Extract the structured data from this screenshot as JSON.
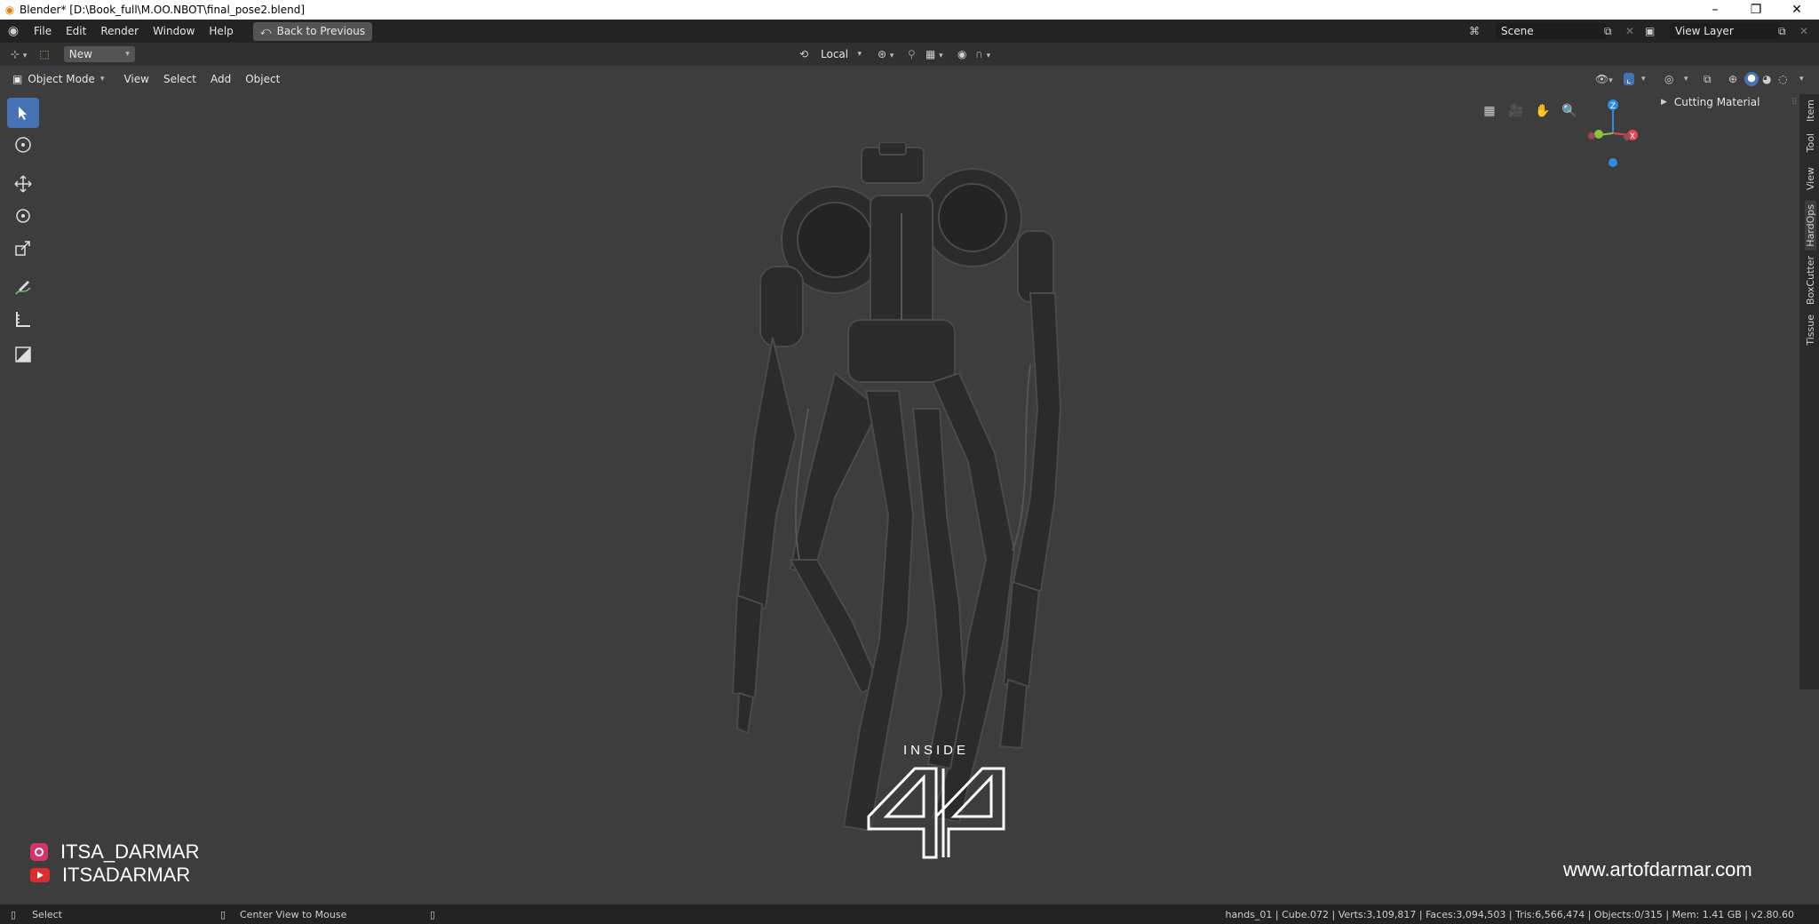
{
  "window": {
    "title": "Blender* [D:\\Book_full\\M.OO.NBOT\\final_pose2.blend]",
    "minimize": "–",
    "restore": "❐",
    "close": "✕"
  },
  "topbar": {
    "menus": [
      "File",
      "Edit",
      "Render",
      "Window",
      "Help"
    ],
    "back_button": "Back to Previous",
    "scene_label": "Scene",
    "view_layer_label": "View Layer"
  },
  "header": {
    "new_label": "New",
    "orientation": "Local"
  },
  "viewport_header": {
    "mode": "Object Mode",
    "menus": [
      "View",
      "Select",
      "Add",
      "Object"
    ]
  },
  "sidebar": {
    "panel_title": "Cutting Material",
    "tabs": [
      "Item",
      "Tool",
      "View",
      "HardOps",
      "BoxCutter",
      "Tissue"
    ]
  },
  "gizmo": {
    "z": "Z",
    "x": "X"
  },
  "overlay": {
    "instagram": "ITSA_DARMAR",
    "youtube": "ITSADARMAR",
    "website": "www.artofdarmar.com",
    "logo_word": "INSIDE"
  },
  "statusbar": {
    "left_action": "Select",
    "middle_action": "Center View to Mouse",
    "stats": "hands_01 | Cube.072 | Verts:3,109,817 | Faces:3,094,503 | Tris:6,566,474 | Objects:0/315 | Mem: 1.41 GB | v2.80.60"
  },
  "colors": {
    "accent": "#4772b3",
    "viewport_bg": "#3d3d3d",
    "axis_x": "#e84352",
    "axis_y": "#8bc33b",
    "axis_z": "#2f8ae0"
  }
}
